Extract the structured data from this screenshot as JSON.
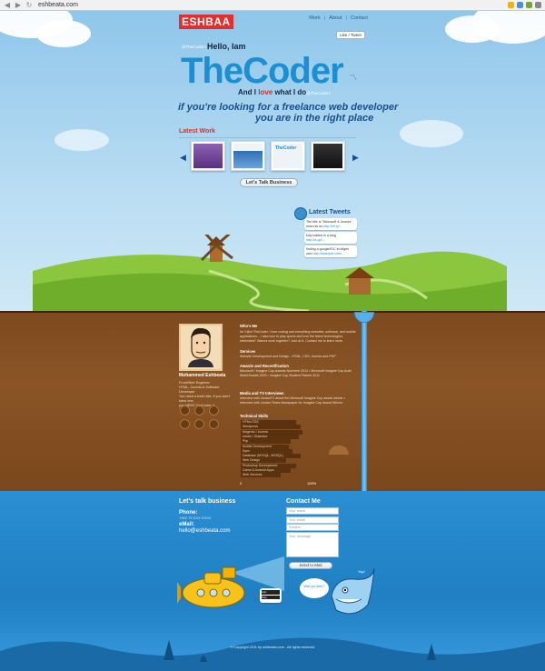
{
  "browser": {
    "url": "eshbeata.com"
  },
  "header": {
    "logo": "ESHBAA",
    "nav": [
      "Work",
      "About",
      "Contact"
    ],
    "nav_sep": "|",
    "subscribe": "Like / Tweet"
  },
  "hero": {
    "handle": "@TheCoderz",
    "hello": "Hello, Iam",
    "big_title": "TheCoder",
    "and_line_1": "And I ",
    "and_love": "love",
    "and_line_2": " what I do",
    "handle2": "@TheCoderz",
    "tagline_1": "if you're looking for a freelance web developer",
    "tagline_2": "you are in the right place"
  },
  "latest_work": {
    "title": "Latest Work",
    "prev": "◀",
    "next": "▶",
    "thumbs": [
      {
        "label": "site-1",
        "color": "#6a3c8c"
      },
      {
        "label": "site-2",
        "color": "#2f6fb3"
      },
      {
        "label": "TheCoder",
        "color": "#dfe8f0"
      },
      {
        "label": "site-4",
        "color": "#1b1b1b"
      }
    ]
  },
  "cta": "Let's Talk Business",
  "tweets": {
    "title": "Latest Tweets",
    "items": [
      {
        "text": "The title is \"Microsoft & Joomla\" when its on",
        "link": "http://bit.ly/..."
      },
      {
        "text": "fully loaded in a blog",
        "link": "http://is.gd/..."
      },
      {
        "text": "finding a google/IDC to bilgen own",
        "link": "http://example.com/..."
      }
    ]
  },
  "about": {
    "name": "Mohammed Eshbeata",
    "role": "Front/Web Engineer\nHTML, Joomla & Software Developer\nYou need a fresh site, if you don't have one,\nyou NEED TheCoder !!",
    "sections": [
      {
        "title": "Who's Me",
        "text": "Im Y@m TheCoder, I love coding and everything websites, software, and mobile applications... I also love to play sports and love the latest technologies. Interested? Wanna work together? Just do it. Contact me to learn more."
      },
      {
        "title": "Services",
        "text": "Website Development and Design - HTML, CSS, Joomla and PHP"
      },
      {
        "title": "Awards and Recertification",
        "text": "Microsoft / Imagine Cup Awards Nominee 2010 • Microsoft Imagine Cup Arab World finalist 2009 • Imagine Cup Student Partner 2011"
      },
      {
        "title": "Media and TV Interviews",
        "text": "Interview with JordanTV about the Microsoft Imagine Cup award winner • Interview with Jordan Times Newspaper for Imagine Cup Award Winner"
      },
      {
        "title": "Technical Skills",
        "text": ""
      }
    ],
    "skills": [
      {
        "name": "HTML/CSS",
        "level": 0.55
      },
      {
        "name": "Wordpress",
        "level": 0.6
      },
      {
        "name": "Magento / Joomla",
        "level": 0.62
      },
      {
        "name": "Adobe / Illustrator",
        "level": 0.58
      },
      {
        "name": "Php",
        "level": 0.5
      },
      {
        "name": "Mobile Development",
        "level": 0.48
      },
      {
        "name": "Sync",
        "level": 0.52
      },
      {
        "name": "Database (MYSQL, MSSQL)",
        "level": 0.6
      },
      {
        "name": "Web Design",
        "level": 0.45
      },
      {
        "name": "Photoshop Development",
        "level": 0.55
      },
      {
        "name": "Game & Android Apps",
        "level": 0.5
      },
      {
        "name": "Web Services",
        "level": 0.4
      }
    ],
    "pct_start": "0",
    "pct_end": "100%"
  },
  "contact": {
    "business_title": "Let's talk business",
    "phone_label": "Phone:",
    "phone_value": "+962 79 XXX XXXX",
    "email_label": "eMail:",
    "email_value": "hello@eshbeata.com",
    "form_title": "Contact Me",
    "name_ph": "Your name",
    "email_ph": "Your email",
    "subject_ph": "Subject",
    "message_ph": "Your message",
    "send": "Send to Mail",
    "bubble": "Wat ya doin?",
    "bubble2": "Yay!"
  },
  "footer": "© Copyright 2011 by eshbeata.com - All rights reserved",
  "colors": {
    "accent_blue": "#1c8ed3",
    "love_red": "#d2322d",
    "brown": "#7d4a1f",
    "water": "#2b8fd3"
  }
}
